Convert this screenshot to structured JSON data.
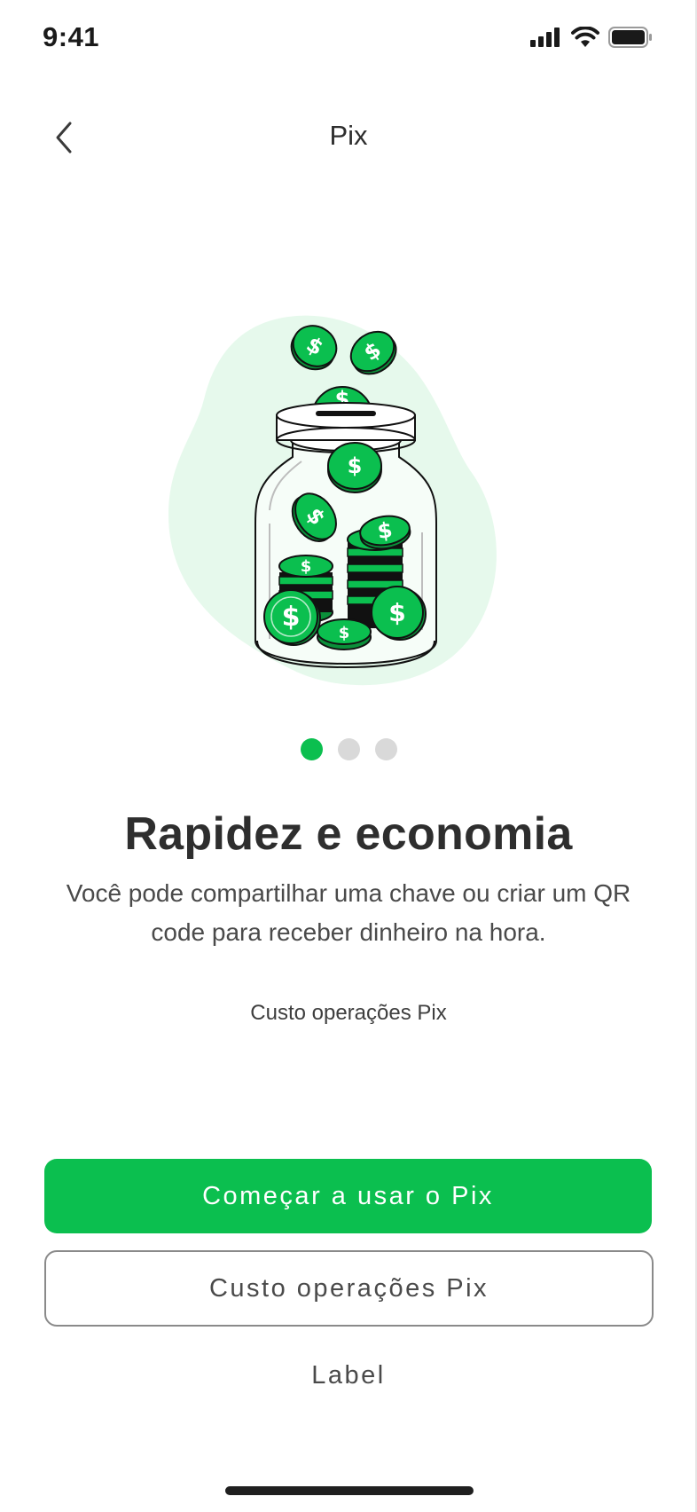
{
  "status_bar": {
    "time": "9:41",
    "icons": [
      "cellular-signal-icon",
      "wifi-icon",
      "battery-icon"
    ]
  },
  "header": {
    "title": "Pix",
    "back_icon": "chevron-left-icon"
  },
  "illustration": {
    "name": "coin-jar-illustration",
    "accent_color": "#0bbf4f",
    "blob_color": "#e6f9ec"
  },
  "pager": {
    "total": 3,
    "current": 1
  },
  "content": {
    "title": "Rapidez e economia",
    "description": "Você pode compartilhar uma chave ou criar um QR code para receber dinheiro na hora.",
    "link": "Custo operações Pix"
  },
  "actions": {
    "primary": "Começar a usar o Pix",
    "secondary": "Custo operações Pix",
    "tertiary": "Label"
  },
  "colors": {
    "brand": "#0bbf4f",
    "text": "#2e2e2e",
    "inactive_dot": "#d9d9d9"
  }
}
